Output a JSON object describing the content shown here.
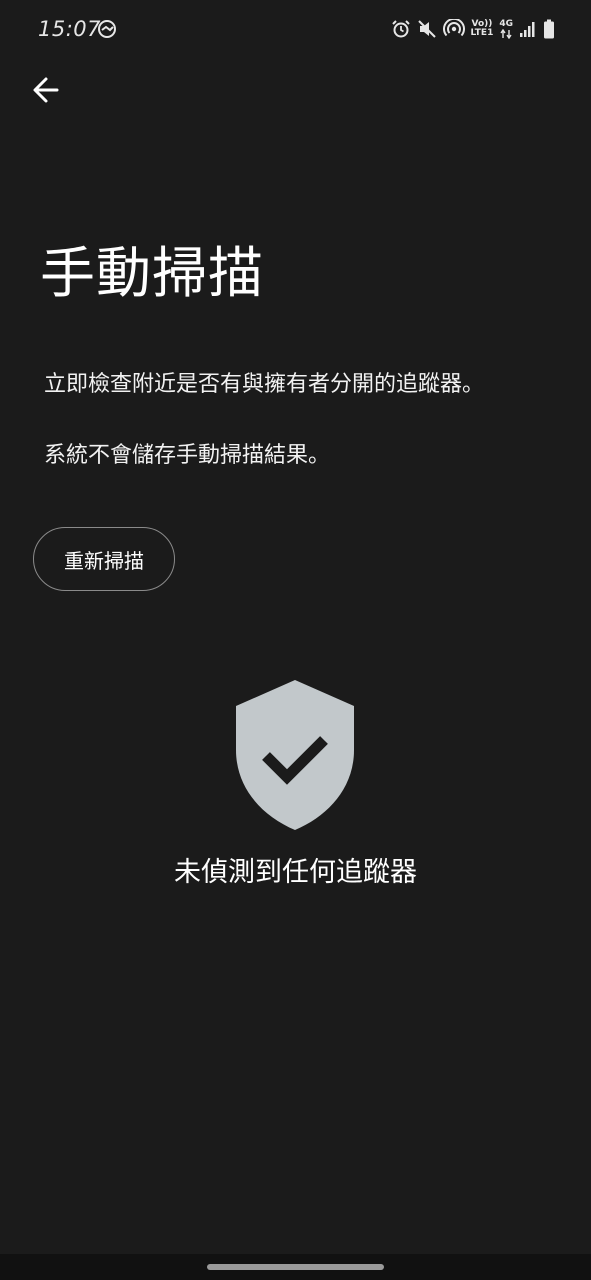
{
  "status_bar": {
    "time": "15:07",
    "network_top": "Vo))",
    "network_bottom": "LTE1",
    "network_type": "4G",
    "icons": [
      "sync-icon",
      "alarm-icon",
      "mute-icon",
      "hotspot-icon",
      "signal-icon",
      "battery-icon"
    ]
  },
  "header": {
    "back_icon": "arrow-left-icon"
  },
  "main": {
    "title": "手動掃描",
    "description_1": "立即檢查附近是否有與擁有者分開的追蹤器。",
    "description_2": "系統不會儲存手動掃描結果。",
    "rescan_label": "重新掃描",
    "result_icon": "shield-check-icon",
    "result_text": "未偵測到任何追蹤器"
  },
  "colors": {
    "background": "#1b1b1b",
    "shield": "#c2c8cb",
    "check": "#1b1b1b",
    "button_border": "#8a8a8a"
  }
}
